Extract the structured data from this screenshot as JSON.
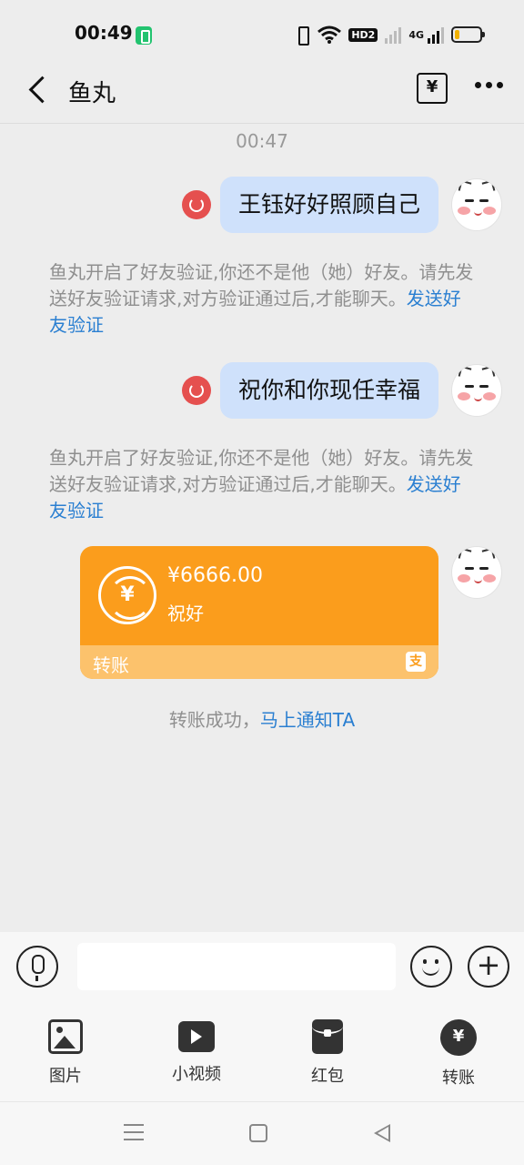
{
  "status_bar": {
    "time": "00:49",
    "network_type": "4G",
    "hd_label": "HD2",
    "battery_level": 0.2
  },
  "header": {
    "title": "鱼丸",
    "transfer_icon": "¥",
    "more_icon": "more-icon"
  },
  "chat": {
    "timestamp": "00:47",
    "messages": [
      {
        "text": "王钰好好照顾自己"
      },
      {
        "text": "祝你和你现任幸福"
      }
    ],
    "notices": [
      {
        "text": "鱼丸开启了好友验证,你还不是他（她）好友。请先发送好友验证请求,对方验证通过后,才能聊天。",
        "link": "发送好友验证"
      },
      {
        "text": "鱼丸开启了好友验证,你还不是他（她）好友。请先发送好友验证请求,对方验证通过后,才能聊天。",
        "link": "发送好友验证"
      }
    ],
    "transfer": {
      "amount": "¥6666.00",
      "note": "祝好",
      "label": "转账",
      "currency_symbol": "¥",
      "brand_mark": "支"
    },
    "transfer_status": {
      "text": "转账成功，",
      "link": "马上通知TA"
    }
  },
  "input": {
    "value": "",
    "placeholder": "",
    "plus_symbol": "+"
  },
  "tools": [
    {
      "label": "图片",
      "icon": "image-icon"
    },
    {
      "label": "小视频",
      "icon": "video-icon"
    },
    {
      "label": "红包",
      "icon": "red-packet-icon"
    },
    {
      "label": "转账",
      "icon": "transfer-icon",
      "symbol": "¥"
    }
  ],
  "colors": {
    "bubble": "#cfe1fb",
    "transfer_card": "#fb9d1c",
    "link": "#2a7fd1",
    "resend": "#e5504f"
  }
}
